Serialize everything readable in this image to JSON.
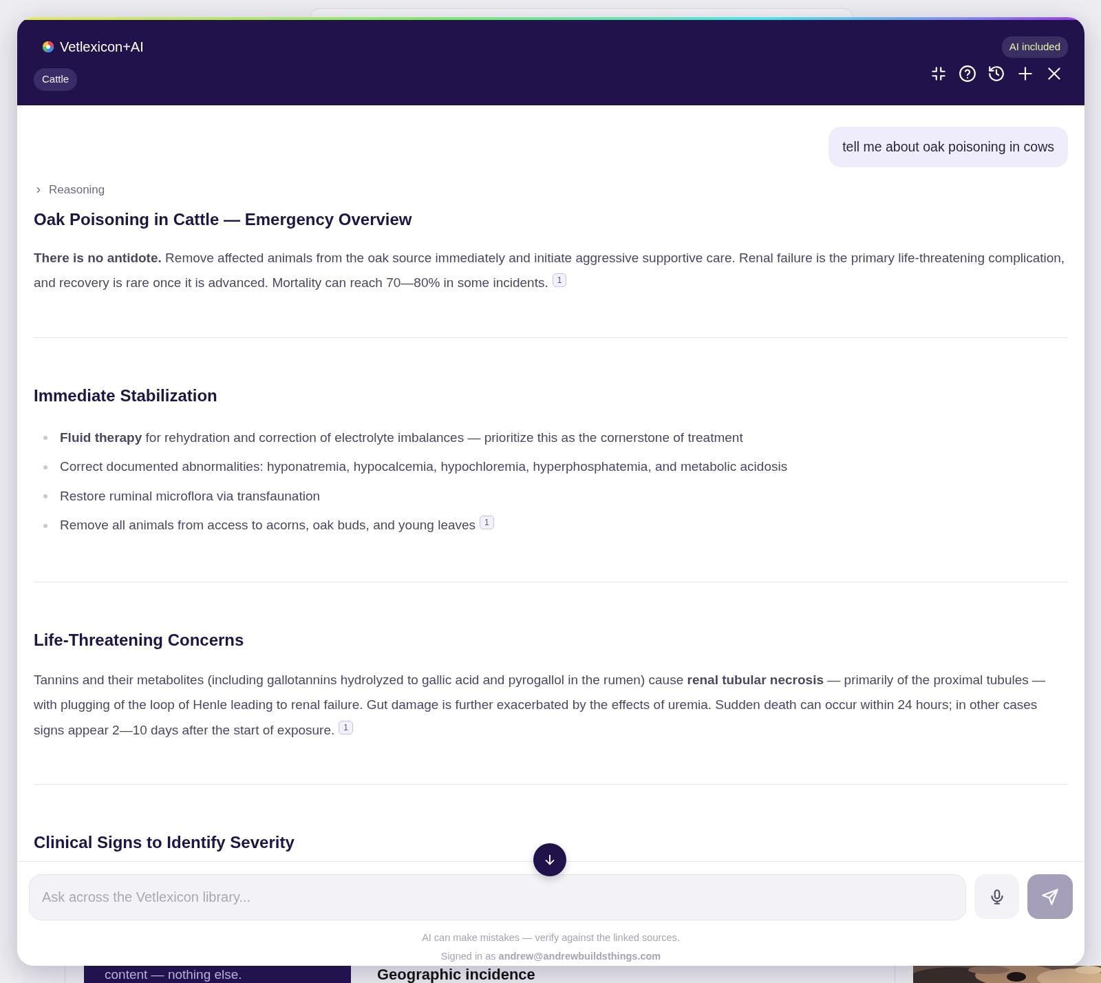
{
  "background_page": {
    "card_text": "content — nothing else.",
    "heading": "Geographic incidence"
  },
  "header": {
    "brand": "Vetlexicon+AI",
    "species_tag": "Cattle",
    "badge": "AI included"
  },
  "user_message": "tell me about oak poisoning in cows",
  "reasoning": {
    "label": "Reasoning",
    "expanded": false
  },
  "answer": {
    "title": "Oak Poisoning in Cattle — Emergency Overview",
    "intro": {
      "text": "**There is no antidote.** Remove affected animals from the oak source immediately and initiate aggressive supportive care. Renal failure is the primary life-threatening complication, and recovery is rare once it is advanced. Mortality can reach 70—80% in some incidents.",
      "citation": "1"
    },
    "sections": [
      {
        "heading": "Immediate Stabilization",
        "kind": "list",
        "items": [
          {
            "text": "**Fluid therapy** for rehydration and correction of electrolyte imbalances — prioritize this as the cornerstone of treatment"
          },
          {
            "text": "Correct documented abnormalities: hyponatremia, hypocalcemia, hypochloremia, hyperphosphatemia, and metabolic acidosis"
          },
          {
            "text": "Restore ruminal microflora via transfaunation"
          },
          {
            "text": "Remove all animals from access to acorns, oak buds, and young leaves",
            "citation": "1"
          }
        ]
      },
      {
        "heading": "Life-Threatening Concerns",
        "kind": "paragraph",
        "text": "Tannins and their metabolites (including gallotannins hydrolyzed to gallic acid and pyrogallol in the rumen) cause **renal tubular necrosis** — primarily of the proximal tubules — with plugging of the loop of Henle leading to renal failure. Gut damage is further exacerbated by the effects of uremia. Sudden death can occur within 24 hours; in other cases signs appear 2—10 days after the start of exposure.",
        "citation": "1"
      },
      {
        "heading": "Clinical Signs to Identify Severity",
        "kind": "paragraph"
      }
    ]
  },
  "composer": {
    "placeholder": "Ask across the Vetlexicon library...",
    "send_disabled": true
  },
  "footer": {
    "disclaimer": "AI can make mistakes — verify against the linked sources.",
    "signed_in": "Signed in as **andrew@andrewbuildsthings.com**"
  }
}
